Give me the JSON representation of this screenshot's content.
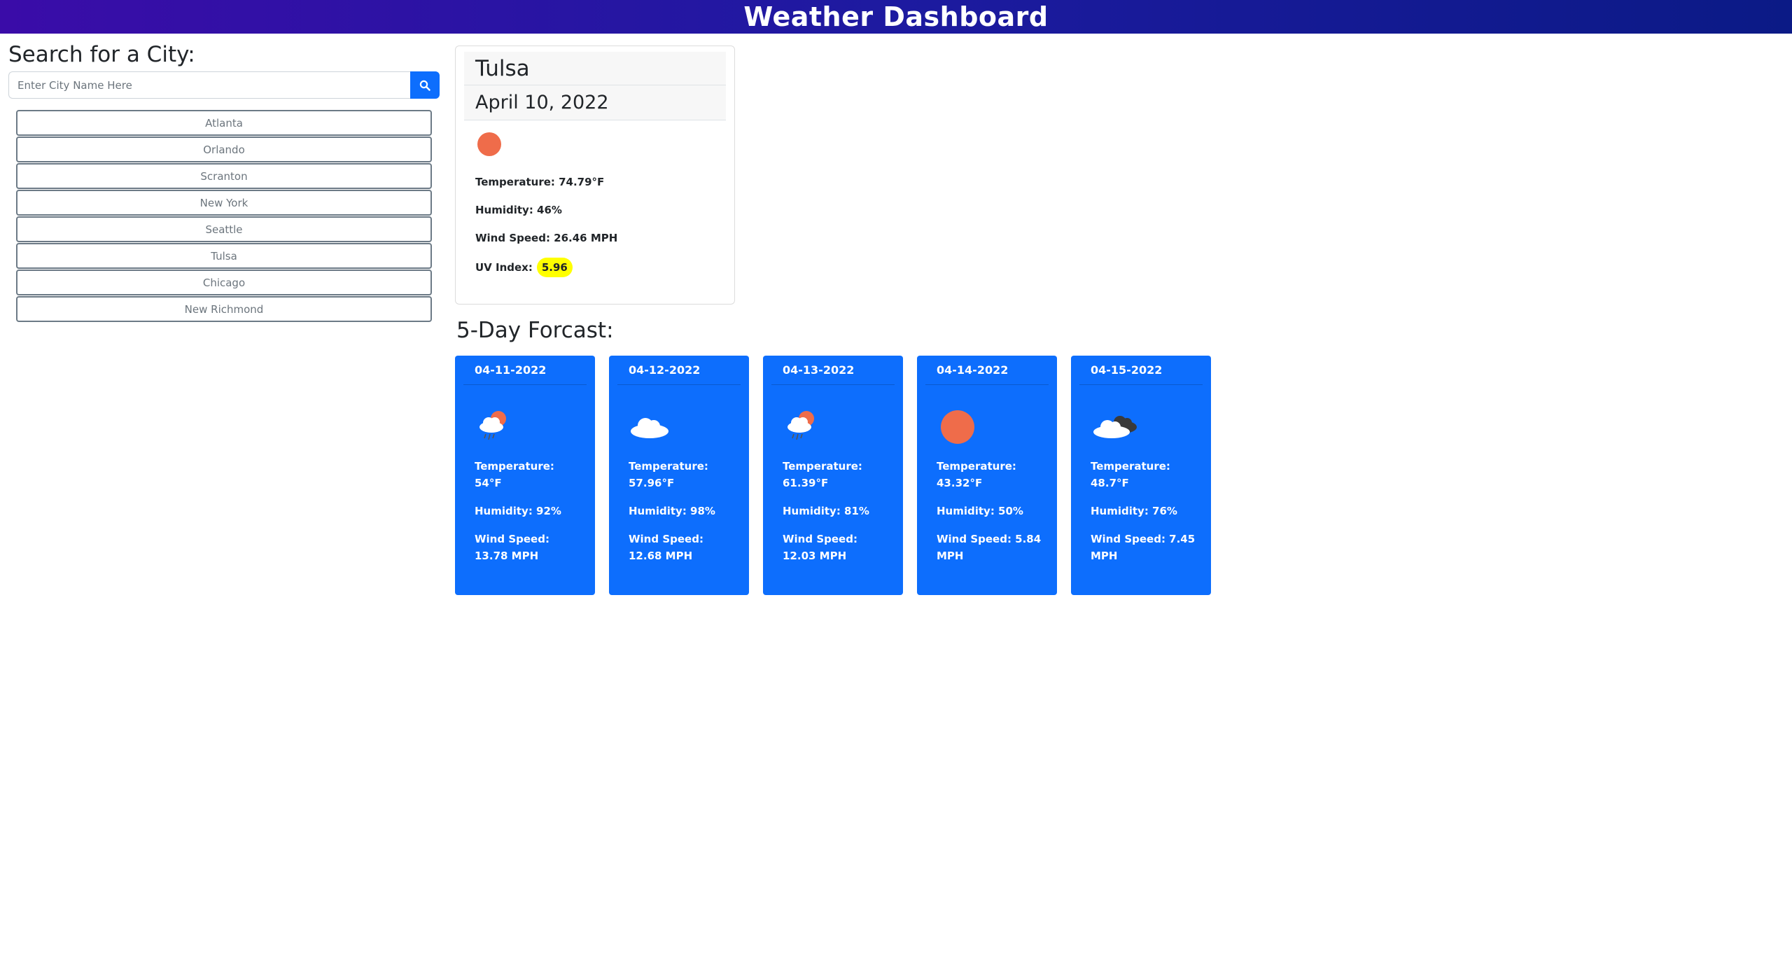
{
  "header": {
    "title": "Weather Dashboard"
  },
  "search": {
    "title": "Search for a City:",
    "placeholder": "Enter City Name Here",
    "button_icon": "search-icon"
  },
  "history": [
    {
      "label": "Atlanta"
    },
    {
      "label": "Orlando"
    },
    {
      "label": "Scranton"
    },
    {
      "label": "New York"
    },
    {
      "label": "Seattle"
    },
    {
      "label": "Tulsa"
    },
    {
      "label": "Chicago"
    },
    {
      "label": "New Richmond"
    }
  ],
  "current": {
    "city": "Tulsa",
    "date": "April 10, 2022",
    "icon": "sun-icon",
    "temperature": "Temperature: 74.79°F",
    "humidity": "Humidity: 46%",
    "wind": "Wind Speed: 26.46 MPH",
    "uv_label": "UV Index:",
    "uv_value": "5.96",
    "uv_color": "#ffff00"
  },
  "forecast": {
    "title": "5-Day Forcast:",
    "card_color": "#0d6efd",
    "days": [
      {
        "date": "04-11-2022",
        "icon": "rain-sun-cloud-icon",
        "temperature": "Temperature: 54°F",
        "humidity": "Humidity: 92%",
        "wind": "Wind Speed: 13.78 MPH"
      },
      {
        "date": "04-12-2022",
        "icon": "cloud-icon",
        "temperature": "Temperature: 57.96°F",
        "humidity": "Humidity: 98%",
        "wind": "Wind Speed: 12.68 MPH"
      },
      {
        "date": "04-13-2022",
        "icon": "rain-sun-cloud-icon",
        "temperature": "Temperature: 61.39°F",
        "humidity": "Humidity: 81%",
        "wind": "Wind Speed: 12.03 MPH"
      },
      {
        "date": "04-14-2022",
        "icon": "sun-icon",
        "temperature": "Temperature: 43.32°F",
        "humidity": "Humidity: 50%",
        "wind": "Wind Speed: 5.84 MPH"
      },
      {
        "date": "04-15-2022",
        "icon": "broken-clouds-icon",
        "temperature": "Temperature: 48.7°F",
        "humidity": "Humidity: 76%",
        "wind": "Wind Speed: 7.45 MPH"
      }
    ]
  }
}
